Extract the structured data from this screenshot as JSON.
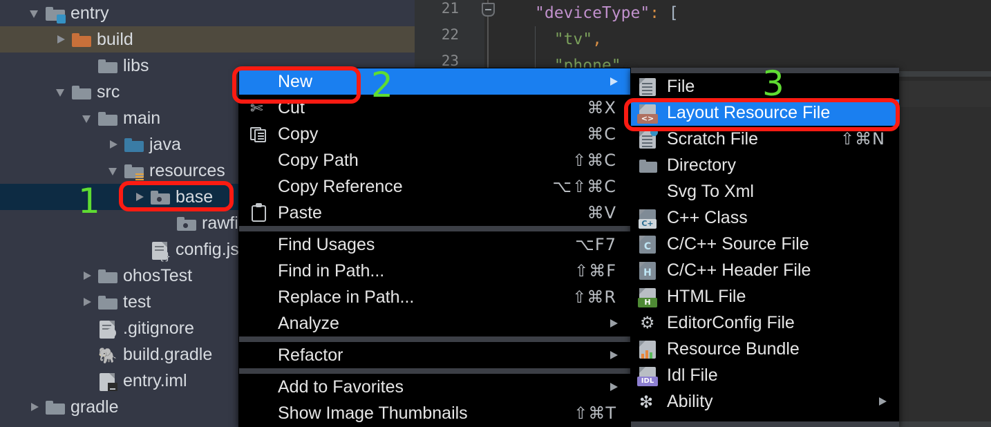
{
  "editor": {
    "lines": [
      {
        "num": "21",
        "tokens": [
          {
            "t": "\"deviceType\"",
            "c": "key"
          },
          {
            "t": ":",
            "c": "punc"
          },
          {
            "t": " [",
            "c": "brk"
          }
        ],
        "indent": 0
      },
      {
        "num": "22",
        "tokens": [
          {
            "t": "  \"tv\"",
            "c": "str"
          },
          {
            "t": ",",
            "c": "punc"
          }
        ],
        "indent": 1
      },
      {
        "num": "23",
        "tokens": [
          {
            "t": "  \"phone\"",
            "c": "str"
          },
          {
            "t": ",",
            "c": "punc"
          }
        ],
        "indent": 1
      }
    ]
  },
  "tree": {
    "items": [
      {
        "label": "entry",
        "indent": 1,
        "arrow": "down",
        "icon": "folder-module",
        "state": "normal"
      },
      {
        "label": "build",
        "indent": 2,
        "arrow": "right",
        "icon": "folder-orange",
        "state": "build-hl"
      },
      {
        "label": "libs",
        "indent": 3,
        "arrow": "none",
        "icon": "folder-grey",
        "state": "normal"
      },
      {
        "label": "src",
        "indent": 2,
        "arrow": "down",
        "icon": "folder-grey",
        "state": "normal"
      },
      {
        "label": "main",
        "indent": 3,
        "arrow": "down",
        "icon": "folder-grey",
        "state": "normal"
      },
      {
        "label": "java",
        "indent": 4,
        "arrow": "right",
        "icon": "folder-blue",
        "state": "normal"
      },
      {
        "label": "resources",
        "indent": 4,
        "arrow": "down",
        "icon": "folder-res",
        "state": "normal"
      },
      {
        "label": "base",
        "indent": 5,
        "arrow": "right",
        "icon": "folder-resdot",
        "state": "selected"
      },
      {
        "label": "rawfile",
        "indent": 6,
        "arrow": "none",
        "icon": "folder-resdot",
        "state": "normal"
      },
      {
        "label": "config.jso",
        "indent": 5,
        "arrow": "none",
        "icon": "file-json",
        "state": "normal"
      },
      {
        "label": "ohosTest",
        "indent": 3,
        "arrow": "right",
        "icon": "folder-grey",
        "state": "normal"
      },
      {
        "label": "test",
        "indent": 3,
        "arrow": "right",
        "icon": "folder-grey",
        "state": "normal"
      },
      {
        "label": "9gitignore",
        "indent": 3,
        "arrow": "none",
        "icon": "file-gitignore",
        "state": "normal"
      },
      {
        "label": "build.gradle",
        "indent": 3,
        "arrow": "none",
        "icon": "file-gradle",
        "state": "normal"
      },
      {
        "label": "entry.iml",
        "indent": 3,
        "arrow": "none",
        "icon": "file-iml",
        "state": "normal"
      },
      {
        "label": "gradle",
        "indent": 1,
        "arrow": "right",
        "icon": "folder-grey",
        "state": "normal"
      }
    ],
    "gitignore_label": ".gitignore"
  },
  "steps": [
    {
      "label": "1"
    },
    {
      "label": "2"
    },
    {
      "label": "3"
    }
  ],
  "context_menu": {
    "items": [
      {
        "label": "New",
        "accel": "",
        "icon": "none",
        "submenu": true,
        "selected": true
      },
      {
        "label": "Cut",
        "accel": "⌘X",
        "icon": "cut",
        "submenu": false,
        "selected": false
      },
      {
        "label": "Copy",
        "accel": "⌘C",
        "icon": "copy",
        "submenu": false,
        "selected": false
      },
      {
        "label": "Copy Path",
        "accel": "⇧⌘C",
        "icon": "none",
        "submenu": false,
        "selected": false
      },
      {
        "label": "Copy Reference",
        "accel": "⌥⇧⌘C",
        "icon": "none",
        "submenu": false,
        "selected": false
      },
      {
        "label": "Paste",
        "accel": "⌘V",
        "icon": "paste",
        "submenu": false,
        "selected": false
      },
      {
        "separator": true
      },
      {
        "label": "Find Usages",
        "accel": "⌥F7",
        "icon": "none",
        "submenu": false,
        "selected": false
      },
      {
        "label": "Find in Path...",
        "accel": "⇧⌘F",
        "icon": "none",
        "submenu": false,
        "selected": false
      },
      {
        "label": "Replace in Path...",
        "accel": "⇧⌘R",
        "icon": "none",
        "submenu": false,
        "selected": false
      },
      {
        "label": "Analyze",
        "accel": "",
        "icon": "none",
        "submenu": true,
        "selected": false
      },
      {
        "separator": true
      },
      {
        "label": "Refactor",
        "accel": "",
        "icon": "none",
        "submenu": true,
        "selected": false
      },
      {
        "separator": true
      },
      {
        "label": "Add to Favorites",
        "accel": "",
        "icon": "none",
        "submenu": true,
        "selected": false
      },
      {
        "label": "Show Image Thumbnails",
        "accel": "⇧⌘T",
        "icon": "none",
        "submenu": false,
        "selected": false
      }
    ]
  },
  "submenu": {
    "items": [
      {
        "label": "File",
        "accel": "",
        "icon": "file-plain",
        "submenu": false,
        "selected": false
      },
      {
        "label": "Layout Resource File",
        "accel": "",
        "icon": "file-layout",
        "submenu": false,
        "selected": true
      },
      {
        "label": "Scratch File",
        "accel": "⇧⌘N",
        "icon": "file-scratch",
        "submenu": false,
        "selected": false
      },
      {
        "label": "Directory",
        "accel": "",
        "icon": "folder",
        "submenu": false,
        "selected": false
      },
      {
        "label": "Svg To Xml",
        "accel": "",
        "icon": "none",
        "submenu": false,
        "selected": false
      },
      {
        "label": "C++ Class",
        "accel": "",
        "icon": "file-cpp",
        "submenu": false,
        "selected": false
      },
      {
        "label": "C/C++ Source File",
        "accel": "",
        "icon": "file-csrc",
        "submenu": false,
        "selected": false
      },
      {
        "label": "C/C++ Header File",
        "accel": "",
        "icon": "file-chdr",
        "submenu": false,
        "selected": false
      },
      {
        "label": "HTML File",
        "accel": "",
        "icon": "file-html",
        "submenu": false,
        "selected": false
      },
      {
        "label": "EditorConfig File",
        "accel": "",
        "icon": "gear",
        "submenu": false,
        "selected": false
      },
      {
        "label": "Resource Bundle",
        "accel": "",
        "icon": "file-bundle",
        "submenu": false,
        "selected": false
      },
      {
        "label": "Idl File",
        "accel": "",
        "icon": "file-idl",
        "submenu": false,
        "selected": false
      },
      {
        "label": "Ability",
        "accel": "",
        "icon": "ability",
        "submenu": true,
        "selected": false
      }
    ]
  },
  "colors": {
    "accent_blue": "#1a7ff0",
    "annotation_red": "#fb1b12",
    "step_green": "#5fdc32",
    "tree_bg": "#343845",
    "selected_row": "#0d2b43",
    "build_row": "#4f4a3e",
    "menu_bg": "#000000"
  }
}
